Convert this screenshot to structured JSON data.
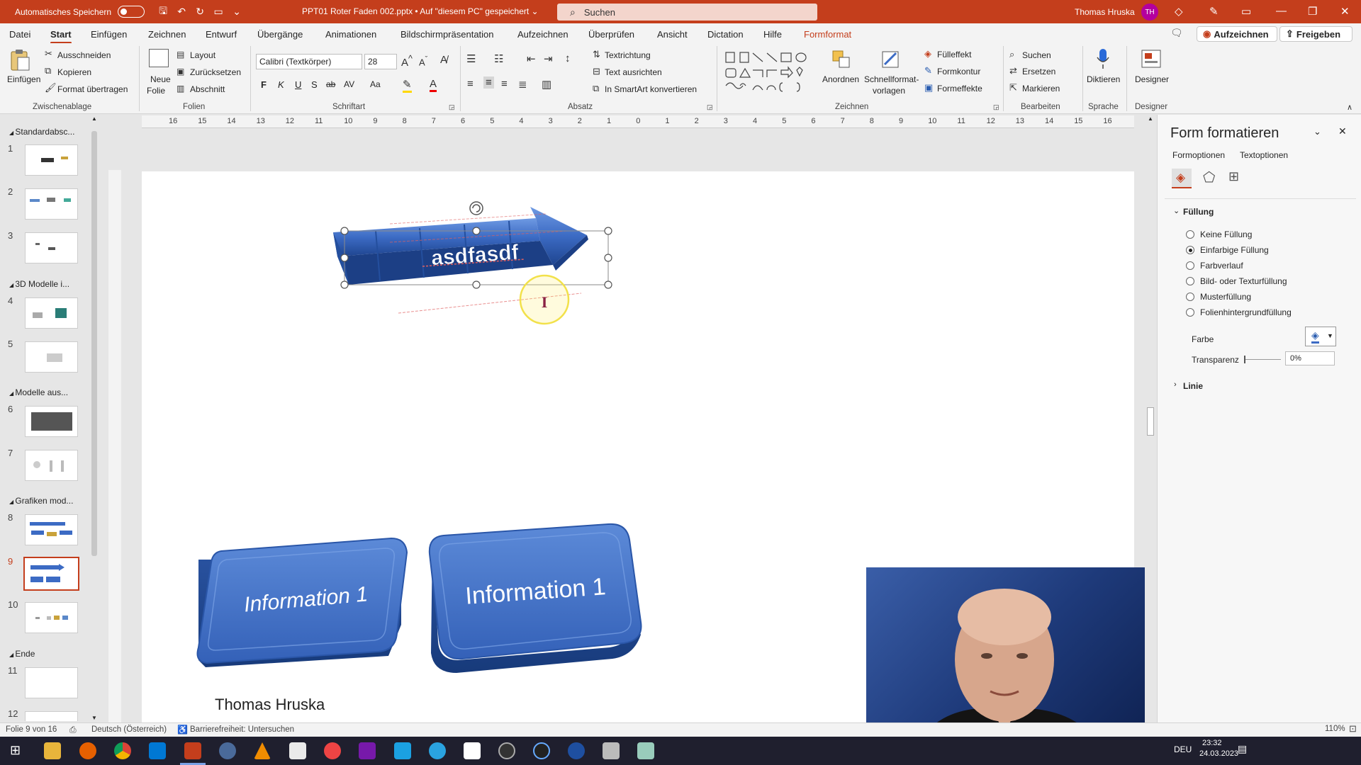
{
  "titlebar": {
    "autosave_label": "Automatisches Speichern",
    "doc_title": "PPT01 Roter Faden 002.pptx • Auf \"diesem PC\" gespeichert ⌄",
    "search_placeholder": "Suchen",
    "user_name": "Thomas Hruska",
    "user_initials": "TH",
    "accent": "#c43e1c"
  },
  "menu": {
    "tabs": [
      "Datei",
      "Start",
      "Einfügen",
      "Zeichnen",
      "Entwurf",
      "Übergänge",
      "Animationen",
      "Bildschirmpräsentation",
      "Aufzeichnen",
      "Überprüfen",
      "Ansicht",
      "Dictation",
      "Hilfe",
      "Formformat"
    ],
    "active": "Start",
    "record_button": "Aufzeichnen",
    "share_button": "Freigeben"
  },
  "ribbon": {
    "clipboard": {
      "paste": "Einfügen",
      "cut": "Ausschneiden",
      "copy": "Kopieren",
      "format_painter": "Format übertragen",
      "group": "Zwischenablage"
    },
    "slides": {
      "new_slide_1": "Neue",
      "new_slide_2": "Folie",
      "layout": "Layout",
      "reset": "Zurücksetzen",
      "section": "Abschnitt",
      "group": "Folien"
    },
    "font": {
      "font_name": "Calibri (Textkörper)",
      "font_size": "28",
      "bold": "F",
      "italic": "K",
      "underline": "U",
      "shadow": "S",
      "strike": "ab",
      "spacing": "AV",
      "case": "Aa",
      "group": "Schriftart"
    },
    "paragraph": {
      "text_direction": "Textrichtung",
      "align_text": "Text ausrichten",
      "smartart": "In SmartArt konvertieren",
      "group": "Absatz"
    },
    "drawing": {
      "arrange": "Anordnen",
      "quick_styles_1": "Schnellformat-",
      "quick_styles_2": "vorlagen",
      "fill": "Fülleffekt",
      "outline": "Formkontur",
      "effects": "Formeffekte",
      "group": "Zeichnen"
    },
    "editing": {
      "find": "Suchen",
      "replace": "Ersetzen",
      "select": "Markieren",
      "group": "Bearbeiten"
    },
    "voice": {
      "dictate": "Diktieren",
      "group": "Sprache"
    },
    "designer": {
      "designer": "Designer",
      "group": "Designer"
    }
  },
  "thumbnails": {
    "sections": [
      "Standardabsc...",
      "3D Modelle i...",
      "Modelle aus...",
      "Grafiken mod...",
      "Ende"
    ],
    "slide_numbers": [
      "1",
      "2",
      "3",
      "4",
      "5",
      "6",
      "7",
      "8",
      "9",
      "10",
      "11",
      "12"
    ],
    "active_slide": 9
  },
  "ruler": {
    "labels": [
      "16",
      "15",
      "14",
      "13",
      "12",
      "11",
      "10",
      "9",
      "8",
      "7",
      "6",
      "5",
      "4",
      "3",
      "2",
      "1",
      "0",
      "1",
      "2",
      "3",
      "4",
      "5",
      "6",
      "7",
      "8",
      "9",
      "10",
      "11",
      "12",
      "13",
      "14",
      "15",
      "16"
    ]
  },
  "slide": {
    "arrow_text": "asdfasdf",
    "button1_text": "Information 1",
    "button2_text": "Information 1",
    "footer_text": "Thomas Hruska",
    "shape_color": "#3c6bc4"
  },
  "format_pane": {
    "title": "Form formatieren",
    "tab_shape": "Formoptionen",
    "tab_text": "Textoptionen",
    "section_fill": "Füllung",
    "options": [
      "Keine Füllung",
      "Einfarbige Füllung",
      "Farbverlauf",
      "Bild- oder Texturfüllung",
      "Musterfüllung",
      "Folienhintergrundfüllung"
    ],
    "selected_option": "Einfarbige Füllung",
    "color_label": "Farbe",
    "transparency_label": "Transparenz",
    "transparency_value": "0%",
    "section_line": "Linie"
  },
  "statusbar": {
    "slide_info": "Folie 9 von 16",
    "language": "Deutsch (Österreich)",
    "accessibility": "Barrierefreiheit: Untersuchen",
    "zoom": "110%"
  },
  "taskbar": {
    "language": "DEU",
    "time": "23:32",
    "date": "24.03.2023"
  }
}
